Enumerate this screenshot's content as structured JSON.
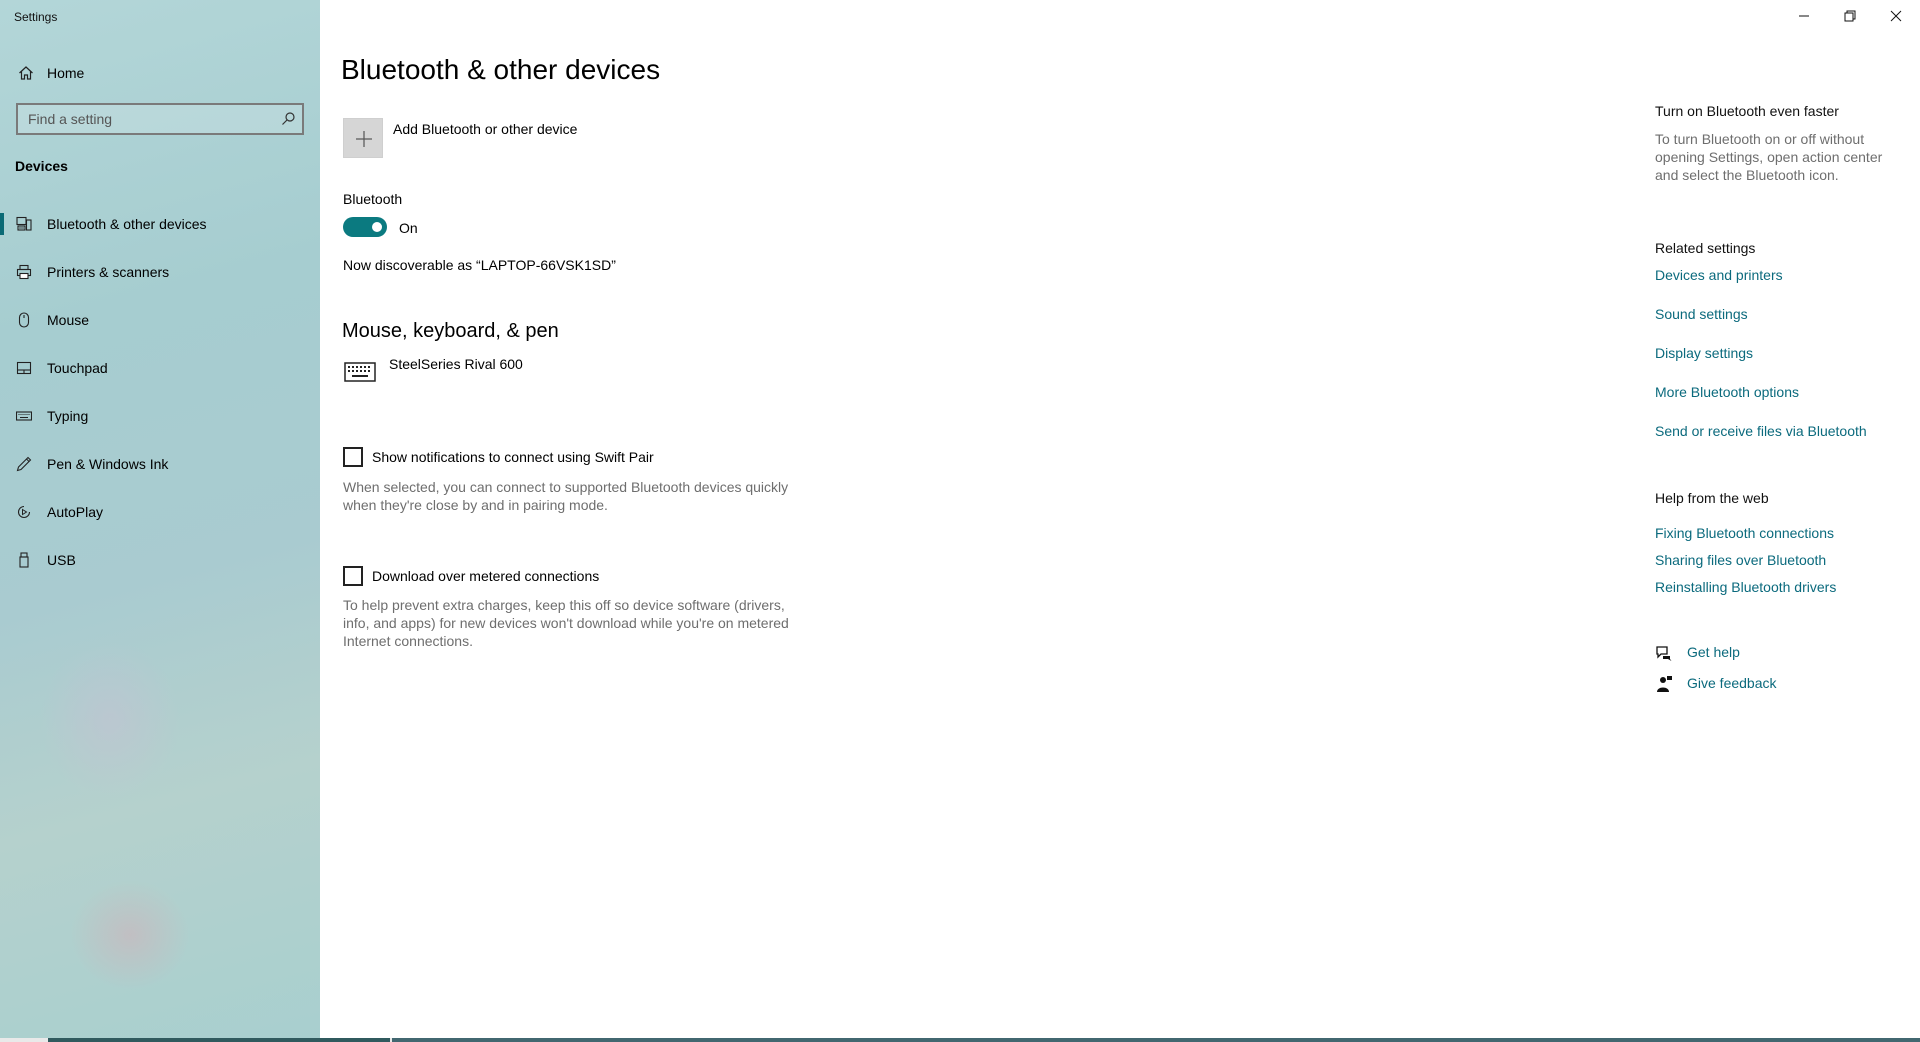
{
  "app": {
    "title": "Settings"
  },
  "sidebar": {
    "home_label": "Home",
    "search_placeholder": "Find a setting",
    "section": "Devices",
    "items": [
      {
        "label": "Bluetooth & other devices",
        "icon": "bluetooth-devices-icon",
        "selected": true
      },
      {
        "label": "Printers & scanners",
        "icon": "printer-icon",
        "selected": false
      },
      {
        "label": "Mouse",
        "icon": "mouse-icon",
        "selected": false
      },
      {
        "label": "Touchpad",
        "icon": "touchpad-icon",
        "selected": false
      },
      {
        "label": "Typing",
        "icon": "keyboard-icon",
        "selected": false
      },
      {
        "label": "Pen & Windows Ink",
        "icon": "pen-icon",
        "selected": false
      },
      {
        "label": "AutoPlay",
        "icon": "autoplay-icon",
        "selected": false
      },
      {
        "label": "USB",
        "icon": "usb-icon",
        "selected": false
      }
    ]
  },
  "main": {
    "title": "Bluetooth & other devices",
    "add_device_label": "Add Bluetooth or other device",
    "bluetooth_label": "Bluetooth",
    "bluetooth_state": "On",
    "discoverable_text": "Now discoverable as “LAPTOP-66VSK1SD”",
    "mouse_section_title": "Mouse, keyboard, & pen",
    "device_name": "SteelSeries Rival 600",
    "swift_pair_label": "Show notifications to connect using Swift Pair",
    "swift_pair_desc": "When selected, you can connect to supported Bluetooth devices quickly when they're close by and in pairing mode.",
    "metered_label": "Download over metered connections",
    "metered_desc": "To help prevent extra charges, keep this off so device software (drivers, info, and apps) for new devices won't download while you're on metered Internet connections."
  },
  "right": {
    "tip_title": "Turn on Bluetooth even faster",
    "tip_text": "To turn Bluetooth on or off without opening Settings, open action center and select the Bluetooth icon.",
    "related_title": "Related settings",
    "related_links": [
      "Devices and printers",
      "Sound settings",
      "Display settings",
      "More Bluetooth options",
      "Send or receive files via Bluetooth"
    ],
    "web_title": "Help from the web",
    "web_links": [
      "Fixing Bluetooth connections",
      "Sharing files over Bluetooth",
      "Reinstalling Bluetooth drivers"
    ],
    "get_help": "Get help",
    "give_feedback": "Give feedback"
  },
  "colors": {
    "accent": "#0b7a80",
    "link": "#0b6a7d",
    "muted": "#6e6e6e"
  }
}
